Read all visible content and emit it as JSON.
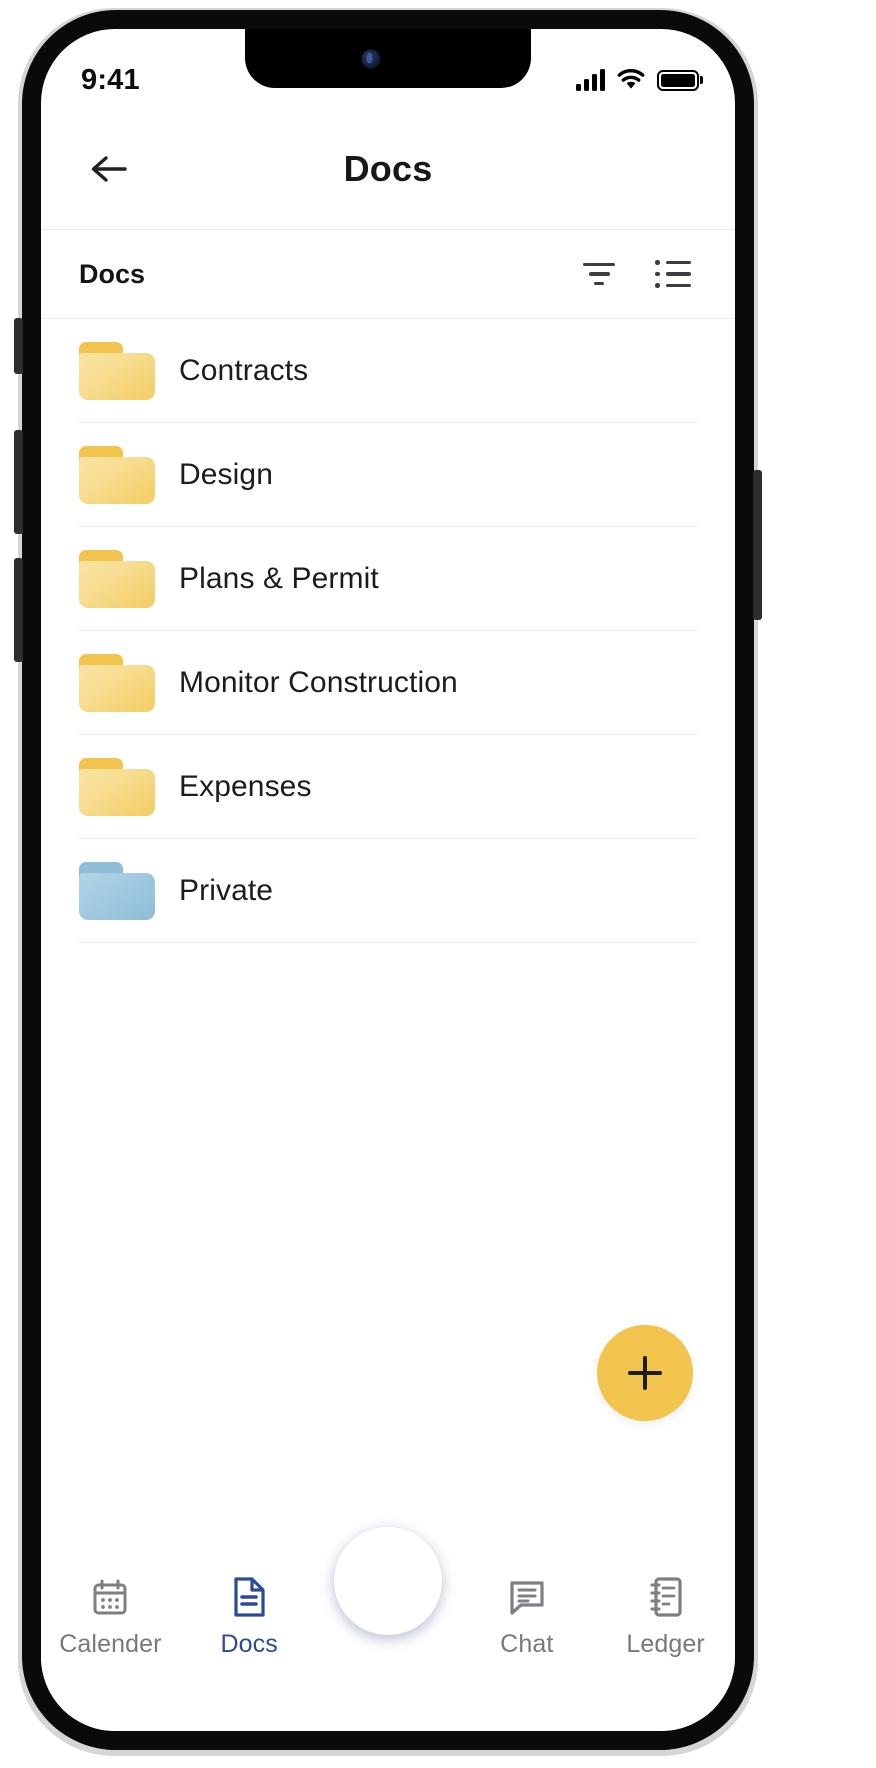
{
  "status_bar": {
    "time": "9:41",
    "signal_icon": "cellular-signal-icon",
    "wifi_icon": "wifi-icon",
    "battery_icon": "battery-full-icon"
  },
  "navbar": {
    "back_icon": "arrow-left-icon",
    "title": "Docs"
  },
  "subheader": {
    "title": "Docs",
    "filter_icon": "filter-icon",
    "list_view_icon": "list-view-icon"
  },
  "folders": [
    {
      "label": "Contracts",
      "color": "#F4CC63",
      "variant": "yellow",
      "icon": "folder-icon"
    },
    {
      "label": "Design",
      "color": "#F4CC63",
      "variant": "yellow",
      "icon": "folder-icon"
    },
    {
      "label": "Plans & Permit",
      "color": "#F4CC63",
      "variant": "yellow",
      "icon": "folder-icon"
    },
    {
      "label": "Monitor Construction",
      "color": "#F4CC63",
      "variant": "yellow",
      "icon": "folder-icon"
    },
    {
      "label": "Expenses",
      "color": "#F4CC63",
      "variant": "yellow",
      "icon": "folder-icon"
    },
    {
      "label": "Private",
      "color": "#8DBDD8",
      "variant": "blue",
      "icon": "folder-icon"
    }
  ],
  "fab": {
    "icon": "plus-icon",
    "color": "#F2C44D"
  },
  "tabbar": {
    "items": [
      {
        "label": "Calender",
        "icon": "calendar-icon",
        "active": false
      },
      {
        "label": "Docs",
        "icon": "document-icon",
        "active": true
      },
      {
        "label": "Chat",
        "icon": "chat-bubble-icon",
        "active": false
      },
      {
        "label": "Ledger",
        "icon": "ledger-icon",
        "active": false
      }
    ],
    "center_action": {
      "icon": "ai-sparkle-icon",
      "color": "#2F4490"
    },
    "active_color": "#2A4B9B",
    "inactive_color": "#77797F"
  }
}
